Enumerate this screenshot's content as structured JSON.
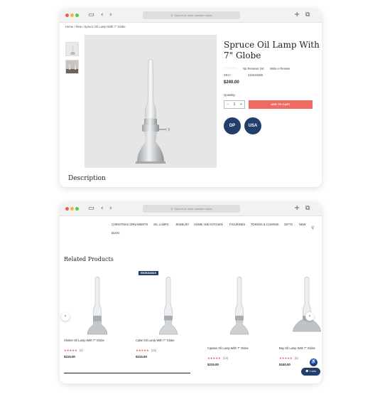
{
  "colors": {
    "accent": "#f06a63",
    "brand_navy": "#213f6a",
    "star": "#e05a54"
  },
  "browser": {
    "address_placeholder": "Search or enter website name",
    "icons": [
      "sidebar-icon",
      "back-icon",
      "forward-icon",
      "search-icon",
      "new-tab-icon",
      "tabs-icon"
    ]
  },
  "product_page": {
    "breadcrumb": "Home / New / Spruce Oil Lamp With 7\" Globe",
    "title": "Spruce Oil Lamp With 7\" Globe",
    "reviews_text": "No Reviews Yet",
    "write_review": "Write A Review",
    "sku_label": "SKU:",
    "sku_value": "410233469",
    "price": "$240.00",
    "quantity_label": "Quantity:",
    "quantity_value": "1",
    "qty_minus": "−",
    "qty_plus": "+",
    "add_to_cart": "ADD TO CART",
    "badge1": "DP",
    "badge2": "USA",
    "description_heading": "Description"
  },
  "listing_page": {
    "nav": [
      "CHRISTMAS ORNAMENTS",
      "OIL LAMPS",
      "JEWELRY",
      "HOME AND KITCHEN",
      "FIGURINES",
      "TOKENS & CHARMS",
      "GIFTS",
      "NEW",
      "BLOG"
    ],
    "related_title": "Related Products",
    "engravable_badge": "ENGRAVABLE",
    "products": [
      {
        "name": "Shelter Oil Lamp With 7\" Globe",
        "stars": "★★★★★",
        "reviews": "(6)",
        "price": "$215.00"
      },
      {
        "name": "Cabin Oil Lamp With 7\" Globe",
        "stars": "★★★★★",
        "reviews": "(15)",
        "price": "$215.00"
      },
      {
        "name": "Captain Oil Lamp With 7\" Globe",
        "stars": "★★★★★",
        "reviews": "(13)",
        "price": "$215.00"
      },
      {
        "name": "Bay Oil Lamp With 7\" Globe",
        "stars": "★★★★★",
        "reviews": "(6)",
        "price": "$240.00"
      }
    ],
    "chat_label": "1 new"
  }
}
